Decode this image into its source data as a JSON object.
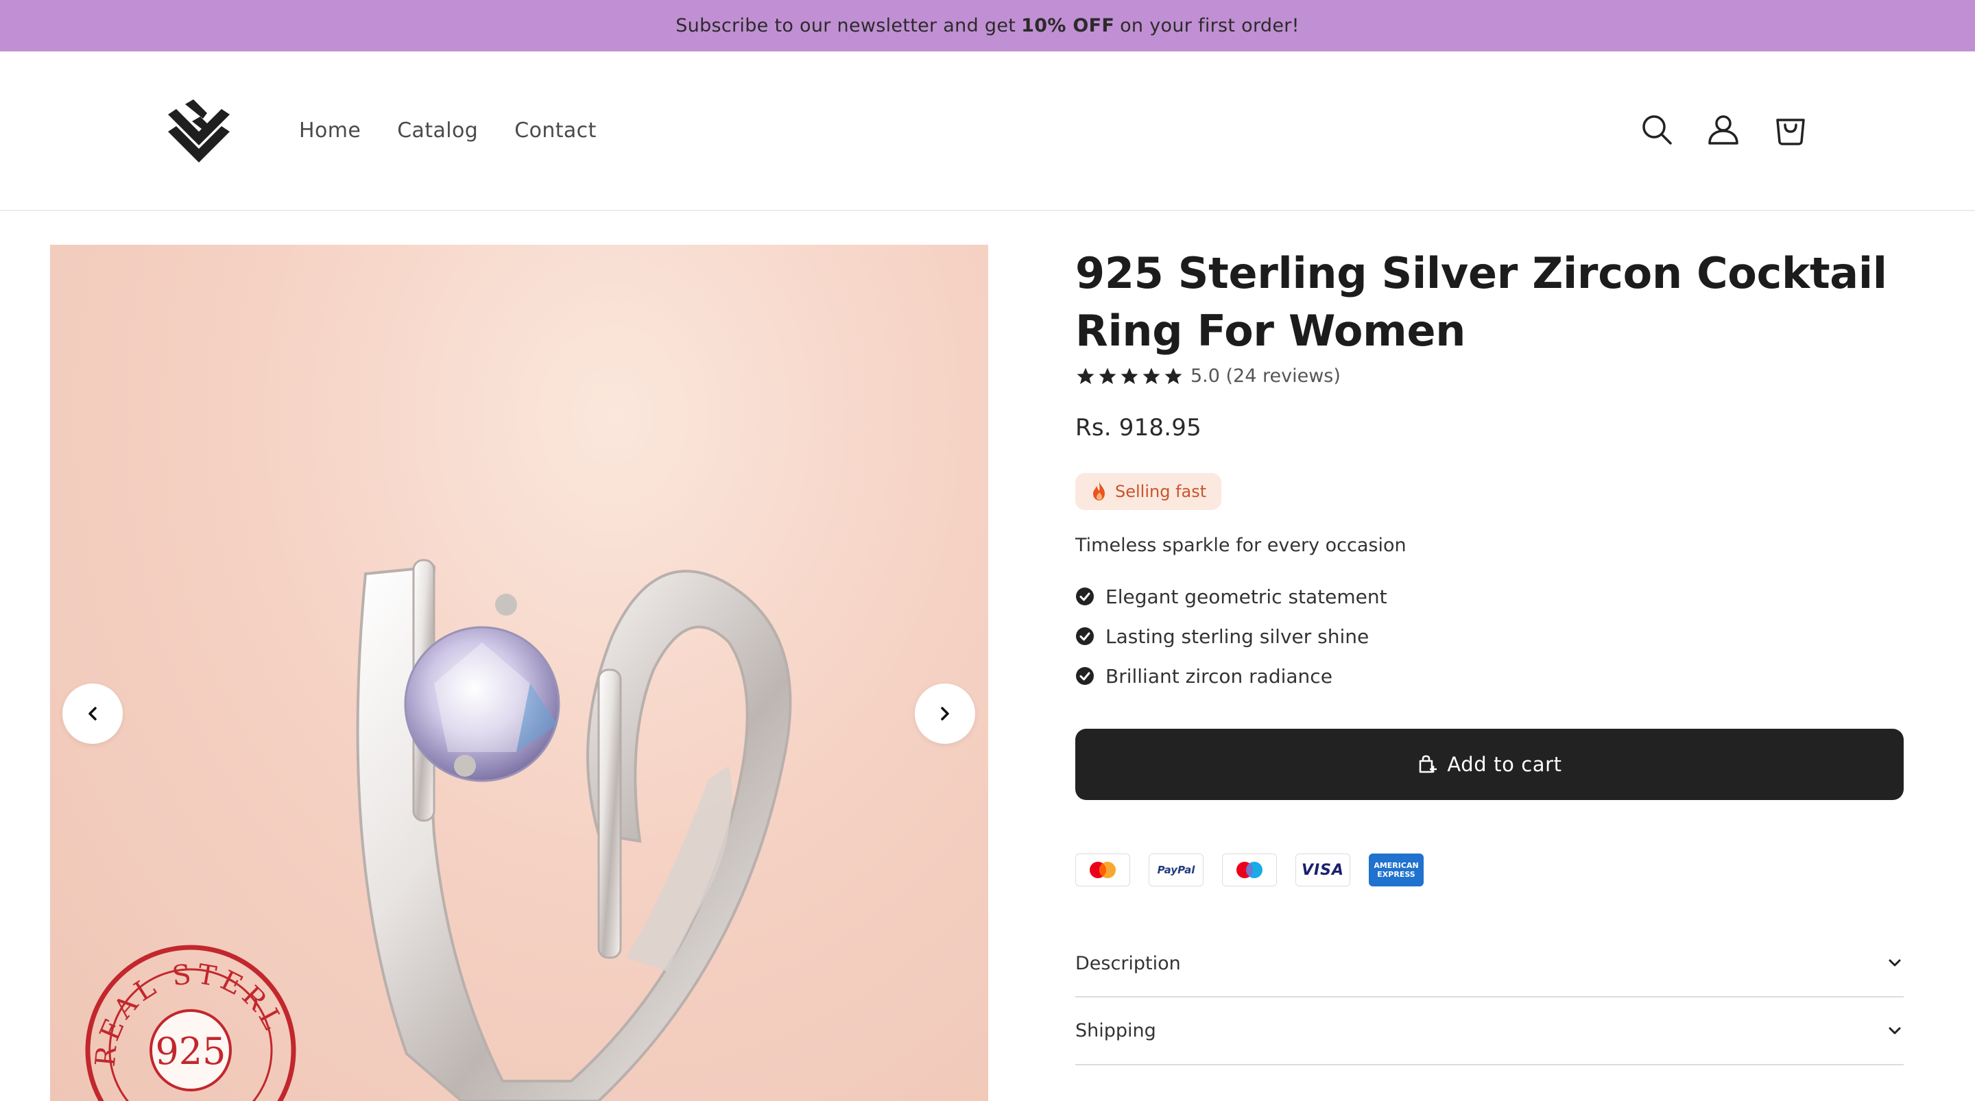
{
  "announcement": {
    "prefix": "Subscribe to our newsletter and get",
    "highlight": "10% OFF",
    "suffix": "on your first order!"
  },
  "nav": {
    "items": [
      "Home",
      "Catalog",
      "Contact"
    ]
  },
  "header_icons": [
    "search-icon",
    "account-icon",
    "cart-icon"
  ],
  "product": {
    "title": "925 Sterling Silver Zircon Cocktail Ring For Women",
    "rating": 5,
    "rating_text": "5.0 (24 reviews)",
    "price": "Rs. 918.95",
    "badge": "Selling fast",
    "tagline": "Timeless sparkle for every occasion",
    "features": [
      "Elegant geometric statement",
      "Lasting sterling silver shine",
      "Brilliant zircon radiance"
    ],
    "add_to_cart": "Add to cart"
  },
  "gallery": {
    "stamp_text": "REAL STERLING",
    "stamp_number": "925"
  },
  "payments": [
    "mastercard-icon",
    "paypal-icon",
    "maestro-icon",
    "visa-icon",
    "american-express-icon"
  ],
  "payment_labels": {
    "paypal": "PayPal",
    "visa": "VISA",
    "amex_line1": "AMERICAN",
    "amex_line2": "EXPRESS"
  },
  "accordion": [
    "Description",
    "Shipping"
  ],
  "colors": {
    "announcement_bg": "#c18fd3",
    "button_bg": "#222222",
    "badge_bg": "#fbe9df",
    "badge_text": "#c8552d"
  }
}
